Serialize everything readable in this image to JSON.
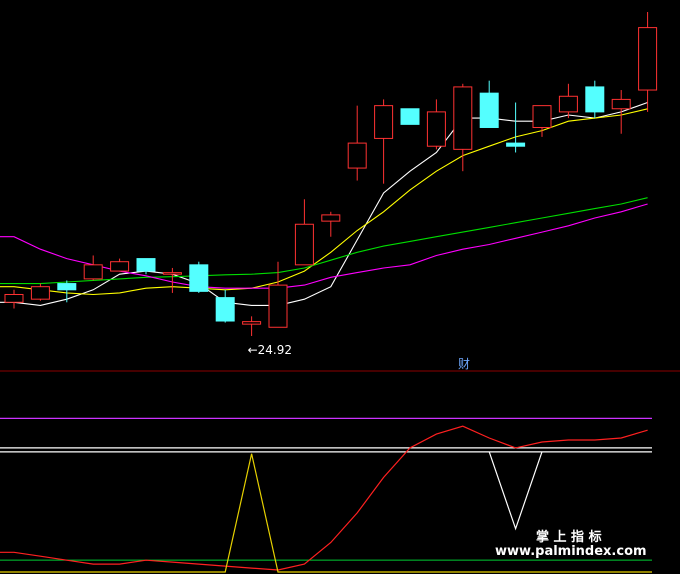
{
  "chart_data": {
    "type": "candlestick",
    "main": {
      "ylim": [
        23.5,
        33
      ],
      "low_annotation": {
        "text": "←24.92",
        "value": 24.92,
        "index": 9
      },
      "candles": [
        {
          "o": 26.0,
          "c": 26.25,
          "h": 26.4,
          "l": 25.8
        },
        {
          "o": 26.1,
          "c": 26.5,
          "h": 26.6,
          "l": 26.05
        },
        {
          "o": 26.6,
          "c": 26.4,
          "h": 26.7,
          "l": 26.0
        },
        {
          "o": 26.75,
          "c": 27.2,
          "h": 27.5,
          "l": 26.7
        },
        {
          "o": 27.0,
          "c": 27.3,
          "h": 27.4,
          "l": 27.0
        },
        {
          "o": 27.4,
          "c": 27.0,
          "h": 27.4,
          "l": 26.9
        },
        {
          "o": 26.9,
          "c": 26.95,
          "h": 27.1,
          "l": 26.3
        },
        {
          "o": 27.2,
          "c": 26.35,
          "h": 27.3,
          "l": 26.3
        },
        {
          "o": 26.15,
          "c": 25.4,
          "h": 26.4,
          "l": 25.35
        },
        {
          "o": 25.3,
          "c": 25.38,
          "h": 25.55,
          "l": 24.92
        },
        {
          "o": 25.2,
          "c": 26.55,
          "h": 27.3,
          "l": 25.2
        },
        {
          "o": 27.2,
          "c": 28.5,
          "h": 29.3,
          "l": 27.2
        },
        {
          "o": 28.6,
          "c": 28.8,
          "h": 28.9,
          "l": 28.1
        },
        {
          "o": 30.3,
          "c": 31.1,
          "h": 32.3,
          "l": 29.9
        },
        {
          "o": 31.25,
          "c": 32.3,
          "h": 32.5,
          "l": 29.8
        },
        {
          "o": 32.2,
          "c": 31.7,
          "h": 32.2,
          "l": 31.7
        },
        {
          "o": 31.0,
          "c": 32.1,
          "h": 32.5,
          "l": 30.9
        },
        {
          "o": 30.9,
          "c": 32.9,
          "h": 33.0,
          "l": 30.2
        },
        {
          "o": 32.7,
          "c": 31.6,
          "h": 33.1,
          "l": 31.6
        },
        {
          "o": 31.1,
          "c": 31.0,
          "h": 32.4,
          "l": 30.8
        },
        {
          "o": 31.6,
          "c": 32.3,
          "h": 32.3,
          "l": 31.3
        },
        {
          "o": 32.1,
          "c": 32.6,
          "h": 33.0,
          "l": 31.9
        },
        {
          "o": 32.9,
          "c": 32.1,
          "h": 33.1,
          "l": 31.9
        },
        {
          "o": 32.2,
          "c": 32.5,
          "h": 32.8,
          "l": 31.4
        },
        {
          "o": 32.8,
          "c": 34.8,
          "h": 35.3,
          "l": 32.1
        }
      ],
      "ma_lines": [
        {
          "color": "#ffffff",
          "values": [
            26.0,
            25.9,
            26.1,
            26.4,
            26.9,
            27.0,
            26.9,
            26.6,
            26.0,
            25.9,
            25.9,
            26.1,
            26.5,
            28.0,
            29.5,
            30.2,
            30.8,
            31.9,
            31.9,
            31.8,
            31.8,
            32.0,
            31.9,
            32.1,
            32.4
          ]
        },
        {
          "color": "#ffff00",
          "values": [
            26.5,
            26.4,
            26.3,
            26.25,
            26.3,
            26.45,
            26.5,
            26.45,
            26.4,
            26.45,
            26.65,
            27.0,
            27.6,
            28.3,
            28.9,
            29.6,
            30.2,
            30.7,
            31.0,
            31.3,
            31.5,
            31.8,
            31.9,
            32.0,
            32.2
          ]
        },
        {
          "color": "#00dd00",
          "values": [
            26.6,
            26.6,
            26.65,
            26.7,
            26.75,
            26.8,
            26.82,
            26.85,
            26.88,
            26.9,
            26.95,
            27.1,
            27.35,
            27.6,
            27.8,
            27.95,
            28.1,
            28.25,
            28.4,
            28.55,
            28.7,
            28.85,
            29.0,
            29.15,
            29.35
          ]
        },
        {
          "color": "#ff00ff",
          "values": [
            28.1,
            27.7,
            27.4,
            27.2,
            27.0,
            26.85,
            26.65,
            26.5,
            26.45,
            26.45,
            26.45,
            26.55,
            26.8,
            26.95,
            27.1,
            27.2,
            27.5,
            27.7,
            27.85,
            28.05,
            28.25,
            28.45,
            28.7,
            28.9,
            29.15
          ]
        }
      ]
    },
    "sub": {
      "label": "财",
      "purple_level": 0.78,
      "white_level": 0.62,
      "green_level": 0.06,
      "red": [
        0.1,
        0.08,
        0.06,
        0.04,
        0.04,
        0.06,
        0.05,
        0.04,
        0.03,
        0.02,
        0.01,
        0.04,
        0.15,
        0.3,
        0.48,
        0.63,
        0.7,
        0.74,
        0.68,
        0.63,
        0.66,
        0.67,
        0.67,
        0.68,
        0.72
      ],
      "yellow_spike": [
        0,
        0,
        0,
        0,
        0,
        0,
        0,
        0,
        0,
        0.6,
        0,
        0,
        0,
        0,
        0,
        0,
        0,
        0,
        0,
        0,
        0,
        0,
        0,
        0,
        0
      ],
      "white_dip": {
        "index": 19,
        "value": 0.22
      }
    }
  },
  "watermark": {
    "cn": "掌 上 指 标",
    "url": "www.palmindex.com"
  },
  "colors": {
    "up": "#ff3232",
    "down": "#54ffff",
    "divider": "#8b0000",
    "label": "#6fa8ff"
  }
}
